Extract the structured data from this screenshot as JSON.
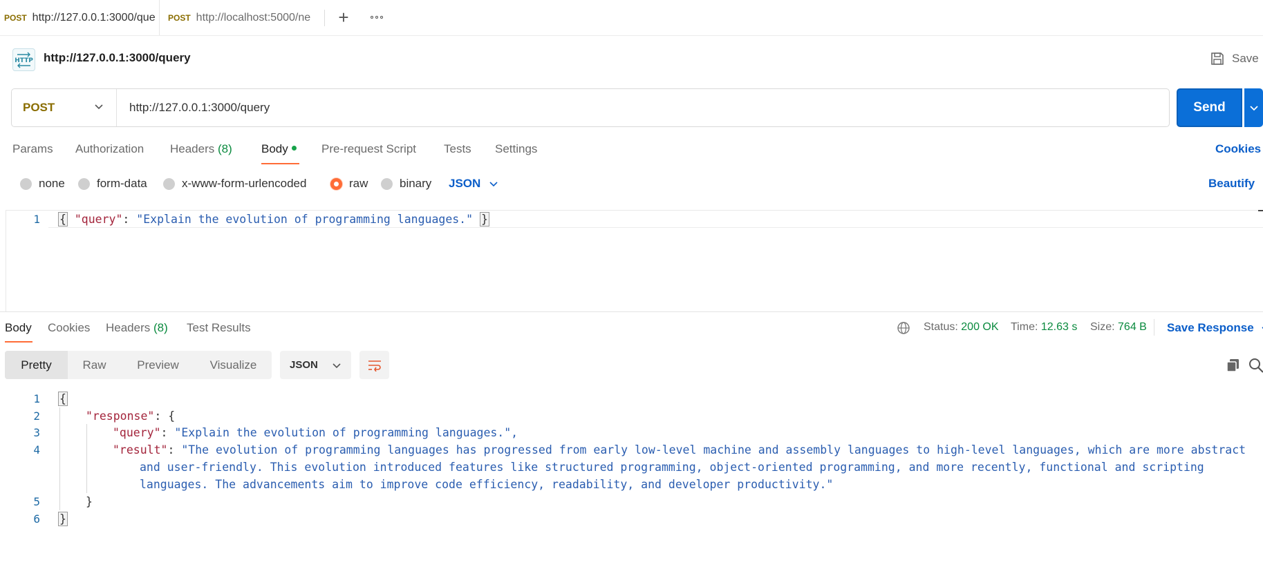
{
  "tabs": [
    {
      "method": "POST",
      "url": "http://127.0.0.1:3000/que"
    },
    {
      "method": "POST",
      "url": "http://localhost:5000/ne"
    }
  ],
  "icons": {
    "new_tab": "plus-icon",
    "more": "more-horizontal-icon",
    "http": "http-icon",
    "save": "save-icon",
    "globe": "globe-icon",
    "copy": "copy-icon",
    "search": "search-icon",
    "wrap": "wrap-lines-icon"
  },
  "request": {
    "title": "http://127.0.0.1:3000/query",
    "save_label": "Save",
    "method": "POST",
    "url": "http://127.0.0.1:3000/query",
    "send_label": "Send"
  },
  "request_tabs": {
    "params": "Params",
    "authorization": "Authorization",
    "headers": "Headers",
    "headers_count": "(8)",
    "body": "Body",
    "pre_request": "Pre-request Script",
    "tests": "Tests",
    "settings": "Settings",
    "cookies": "Cookies"
  },
  "body_options": {
    "none": "none",
    "form_data": "form-data",
    "urlencoded": "x-www-form-urlencoded",
    "raw": "raw",
    "binary": "binary",
    "selected": "raw",
    "format": "JSON",
    "beautify": "Beautify"
  },
  "request_body": {
    "line_no": "1",
    "open": "{",
    "key": "\"query\"",
    "colon": ": ",
    "value": "\"Explain the evolution of programming languages.\"",
    "close": "}"
  },
  "response_tabs": {
    "body": "Body",
    "cookies": "Cookies",
    "headers": "Headers",
    "headers_count": "(8)",
    "test_results": "Test Results"
  },
  "response_meta": {
    "status_label": "Status:",
    "status_value": "200 OK",
    "time_label": "Time:",
    "time_value": "12.63 s",
    "size_label": "Size:",
    "size_value": "764 B",
    "save_response": "Save Response"
  },
  "response_view": {
    "modes": [
      "Pretty",
      "Raw",
      "Preview",
      "Visualize"
    ],
    "active_mode": "Pretty",
    "format": "JSON"
  },
  "response_body": {
    "line_numbers": [
      "1",
      "2",
      "3",
      "4",
      "5",
      "6"
    ],
    "open": "{",
    "response_key": "\"response\"",
    "response_after": ": {",
    "query_key": "\"query\"",
    "query_value": "\"Explain the evolution of programming languages.\",",
    "result_key": "\"result\"",
    "result_line1": "\"The evolution of programming languages has progressed from early low-level machine and assembly languages to high-level languages, which are more abstract",
    "result_line2": "and user-friendly. This evolution introduced features like structured programming, object-oriented programming, and more recently, functional and scripting",
    "result_line3": "languages. The advancements aim to improve code efficiency, readability, and developer productivity.\"",
    "inner_close": "}",
    "close": "}"
  }
}
